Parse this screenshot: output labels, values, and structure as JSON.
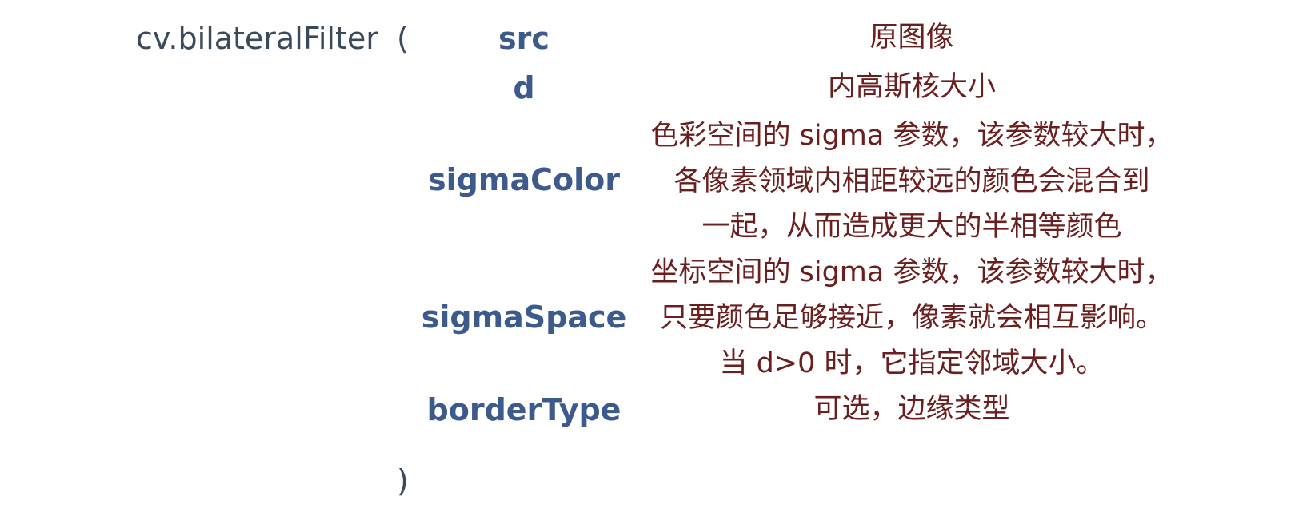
{
  "function": {
    "name": "cv.bilateralFilter",
    "open_paren": "(",
    "close_paren": ")"
  },
  "params": [
    {
      "name": "src",
      "desc_lines": [
        "原图像"
      ]
    },
    {
      "name": "d",
      "desc_lines": [
        "内高斯核大小"
      ]
    },
    {
      "name": "sigmaColor",
      "desc_lines": [
        "色彩空间的 sigma 参数，该参数较大时，",
        "各像素领域内相距较远的颜色会混合到",
        "一起，从而造成更大的半相等颜色"
      ]
    },
    {
      "name": "sigmaSpace",
      "desc_lines": [
        "坐标空间的 sigma 参数，该参数较大时，",
        "只要颜色足够接近，像素就会相互影响。",
        "当 d>0 时，它指定邻域大小。"
      ]
    },
    {
      "name": "borderType",
      "desc_lines": [
        "可选，边缘类型"
      ]
    }
  ],
  "colors": {
    "function_text": "#3b4a5a",
    "param_text": "#3d5a8c",
    "desc_text": "#6b1e1e",
    "background": "#ffffff"
  }
}
